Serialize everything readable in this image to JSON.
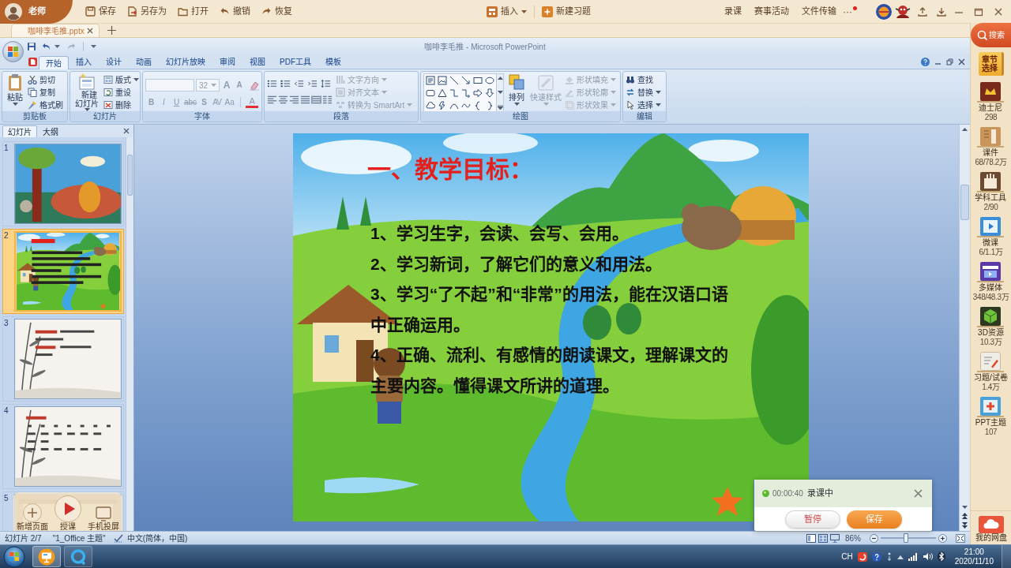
{
  "app_bar": {
    "user": "老师",
    "actions": [
      "保存",
      "另存为",
      "打开",
      "撤销",
      "恢复"
    ],
    "insert": "插入",
    "new_exercise": "新建习题",
    "links": [
      "录课",
      "赛事活动",
      "文件传输"
    ],
    "more": "···",
    "more_badge": true
  },
  "doc_tabs": [
    {
      "label": "咖啡李毛推.pptx",
      "selected": true
    }
  ],
  "window": {
    "title": "咖啡李毛推 - Microsoft PowerPoint"
  },
  "ribbon_tabs": [
    {
      "label": "开始",
      "selected": true
    },
    {
      "label": "插入",
      "selected": false
    },
    {
      "label": "设计",
      "selected": false
    },
    {
      "label": "动画",
      "selected": false
    },
    {
      "label": "幻灯片放映",
      "selected": false
    },
    {
      "label": "审阅",
      "selected": false
    },
    {
      "label": "视图",
      "selected": false
    },
    {
      "label": "PDF工具",
      "selected": false
    },
    {
      "label": "模板",
      "selected": false
    }
  ],
  "ribbon_groups": [
    {
      "label": "剪贴板",
      "columns": [
        {
          "kind": "large",
          "label": "粘贴",
          "menu": true,
          "disabled": false
        },
        {
          "kind": "stack",
          "items": [
            {
              "label": "剪切",
              "menu": false,
              "disabled": false
            },
            {
              "label": "复制",
              "menu": false,
              "disabled": false
            },
            {
              "label": "格式刷",
              "menu": false,
              "disabled": false
            }
          ]
        }
      ]
    },
    {
      "label": "幻灯片",
      "columns": [
        {
          "kind": "large",
          "label": "新建幻灯片",
          "menu": true,
          "disabled": false
        },
        {
          "kind": "stack",
          "items": [
            {
              "label": "版式",
              "menu": true,
              "disabled": false
            },
            {
              "label": "重设",
              "menu": false,
              "disabled": false
            },
            {
              "label": "删除",
              "menu": false,
              "disabled": false
            }
          ]
        }
      ]
    },
    {
      "label": "字体",
      "columns": [
        {
          "kind": "font",
          "font_size": "32",
          "size_tools": [
            "A",
            "A"
          ],
          "format_tools": [
            "B",
            "I",
            "U",
            "abc",
            "S",
            "AV",
            "Aa"
          ],
          "color_tool": "A",
          "disabled": true
        }
      ]
    },
    {
      "label": "段落",
      "columns": [
        {
          "kind": "paragraph"
        },
        {
          "kind": "stack",
          "items": [
            {
              "label": "文字方向",
              "menu": true,
              "disabled": true
            },
            {
              "label": "对齐文本",
              "menu": true,
              "disabled": true
            },
            {
              "label": "转换为 SmartArt",
              "menu": true,
              "disabled": true
            }
          ]
        }
      ]
    },
    {
      "label": "绘图",
      "columns": [
        {
          "kind": "shapes"
        },
        {
          "kind": "large",
          "label": "排列",
          "menu": true,
          "disabled": false
        },
        {
          "kind": "large",
          "label": "快速样式",
          "menu": true,
          "disabled": true
        },
        {
          "kind": "stack",
          "items": [
            {
              "label": "形状填充",
              "menu": true,
              "disabled": true
            },
            {
              "label": "形状轮廓",
              "menu": true,
              "disabled": true
            },
            {
              "label": "形状效果",
              "menu": true,
              "disabled": true
            }
          ]
        }
      ]
    },
    {
      "label": "编辑",
      "columns": [
        {
          "kind": "stack",
          "items": [
            {
              "label": "查找",
              "menu": false,
              "disabled": false
            },
            {
              "label": "替换",
              "menu": true,
              "disabled": false
            },
            {
              "label": "选择",
              "menu": true,
              "disabled": false
            }
          ]
        }
      ]
    }
  ],
  "slide_panel": {
    "tabs": [
      {
        "label": "幻灯片",
        "selected": true
      },
      {
        "label": "大纲",
        "selected": false
      }
    ],
    "slides": [
      {
        "number": "1",
        "kind": "forest",
        "selected": false,
        "hovered": false
      },
      {
        "number": "2",
        "kind": "meadow",
        "selected": true,
        "hovered": false
      },
      {
        "number": "3",
        "kind": "notes",
        "selected": false,
        "hovered": false
      },
      {
        "number": "4",
        "kind": "drills",
        "selected": false,
        "hovered": false
      },
      {
        "number": "5",
        "kind": "scroll",
        "selected": false,
        "hovered": true
      }
    ],
    "hover_actions": [
      "新增页面",
      "授课",
      "手机投屏"
    ]
  },
  "slide": {
    "title": "一、教学目标：",
    "lines": [
      "1、学习生字，会读、会写、会用。",
      "2、学习新词，了解它们的意义和用法。",
      "3、学习“了不起”和“非常”的用法，能在汉语口语中正确运用。",
      "4、正确、流利、有感情的朗读课文，理解课文的主要内容。懂得课文所讲的道理。"
    ]
  },
  "status_bar": {
    "slide": "幻灯片 2/7",
    "theme": "\"1_Office 主题\"",
    "language": "中文(简体，中国)",
    "zoom": "86%",
    "zoom_slider": {
      "level": 0.45
    }
  },
  "recording": {
    "time": "00:00:40",
    "status": "录课中",
    "buttons": [
      {
        "label": "暂停",
        "kind": "secondary"
      },
      {
        "label": "保存",
        "kind": "primary"
      }
    ]
  },
  "resource_bar": {
    "search": "搜索",
    "chapter": "章节选择",
    "items": [
      {
        "label": "迪士尼",
        "count": "298"
      },
      {
        "label": "课件",
        "count": "68/78.2万"
      },
      {
        "label": "学科工具",
        "count": "2/90"
      },
      {
        "label": "微课",
        "count": "6/1.1万"
      },
      {
        "label": "多媒体",
        "count": "348/48.3万"
      },
      {
        "label": "3D资源",
        "count": "10.3万"
      },
      {
        "label": "习题/试卷",
        "count": "1.4万"
      },
      {
        "label": "PPT主题",
        "count": "107"
      }
    ],
    "cloud": "我的网盘"
  },
  "taskbar": {
    "input_language": "CH",
    "time": "21:00",
    "date": "2020/11/10"
  }
}
